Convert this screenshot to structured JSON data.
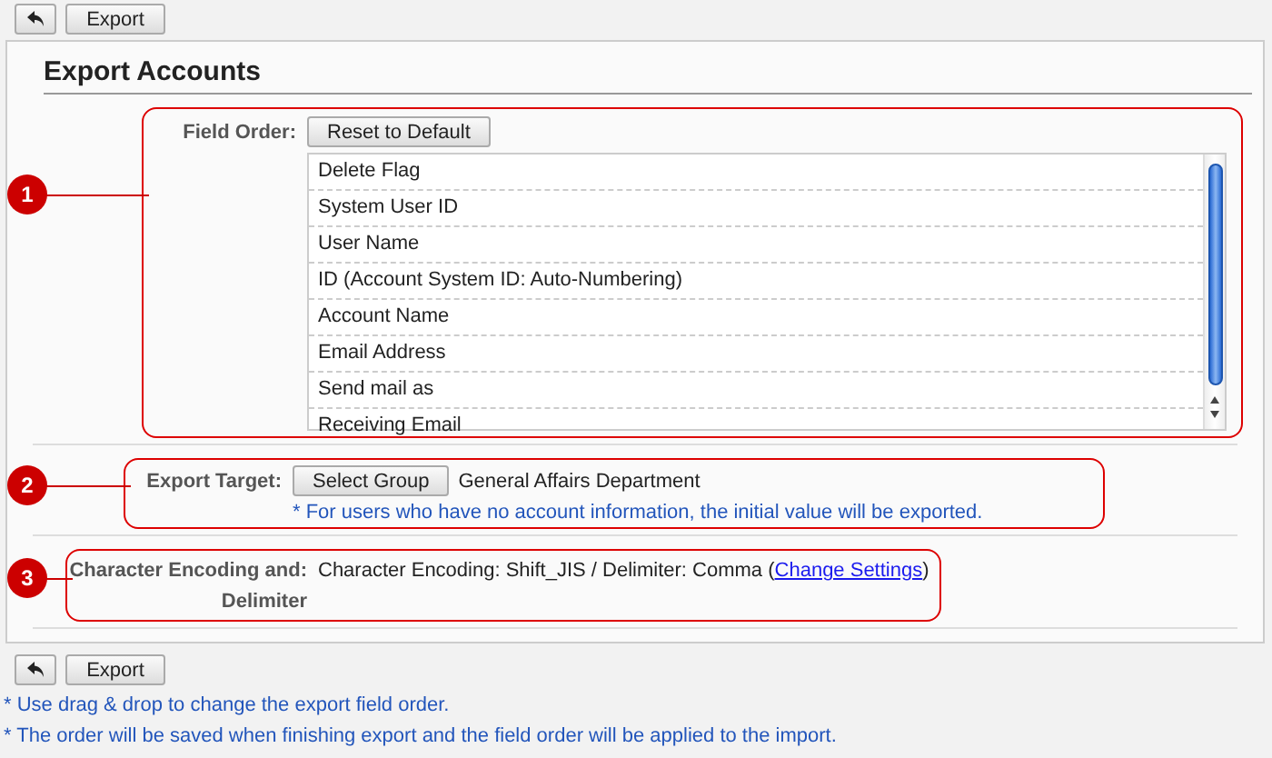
{
  "top_toolbar": [
    {
      "kind": "back"
    },
    {
      "kind": "text",
      "label": "Export"
    }
  ],
  "title": "Export Accounts",
  "sections": [
    {
      "marker": "1",
      "kind": "list",
      "label": "Field Order:",
      "button": "Reset to Default",
      "items": [
        "Delete Flag",
        "System User ID",
        "User Name",
        "ID (Account System ID: Auto-Numbering)",
        "Account Name",
        "Email Address",
        "Send mail as",
        "Receiving Email"
      ]
    },
    {
      "marker": "2",
      "kind": "target",
      "label": "Export Target:",
      "button": "Select Group",
      "value": "General Affairs Department",
      "note": "* For users who have no account information, the initial value will be exported."
    },
    {
      "marker": "3",
      "kind": "encoding",
      "label": "Character Encoding and:",
      "label_line2": "Delimiter",
      "value": "Character Encoding: Shift_JIS / Delimiter: Comma (",
      "link": "Change Settings",
      "value_end": ")"
    }
  ],
  "bottom_toolbar": [
    {
      "kind": "back"
    },
    {
      "kind": "text",
      "label": "Export"
    }
  ],
  "notes": [
    "* Use drag & drop to change the export field order.",
    "* The order will be saved when finishing export and the field order will be applied to the import."
  ]
}
